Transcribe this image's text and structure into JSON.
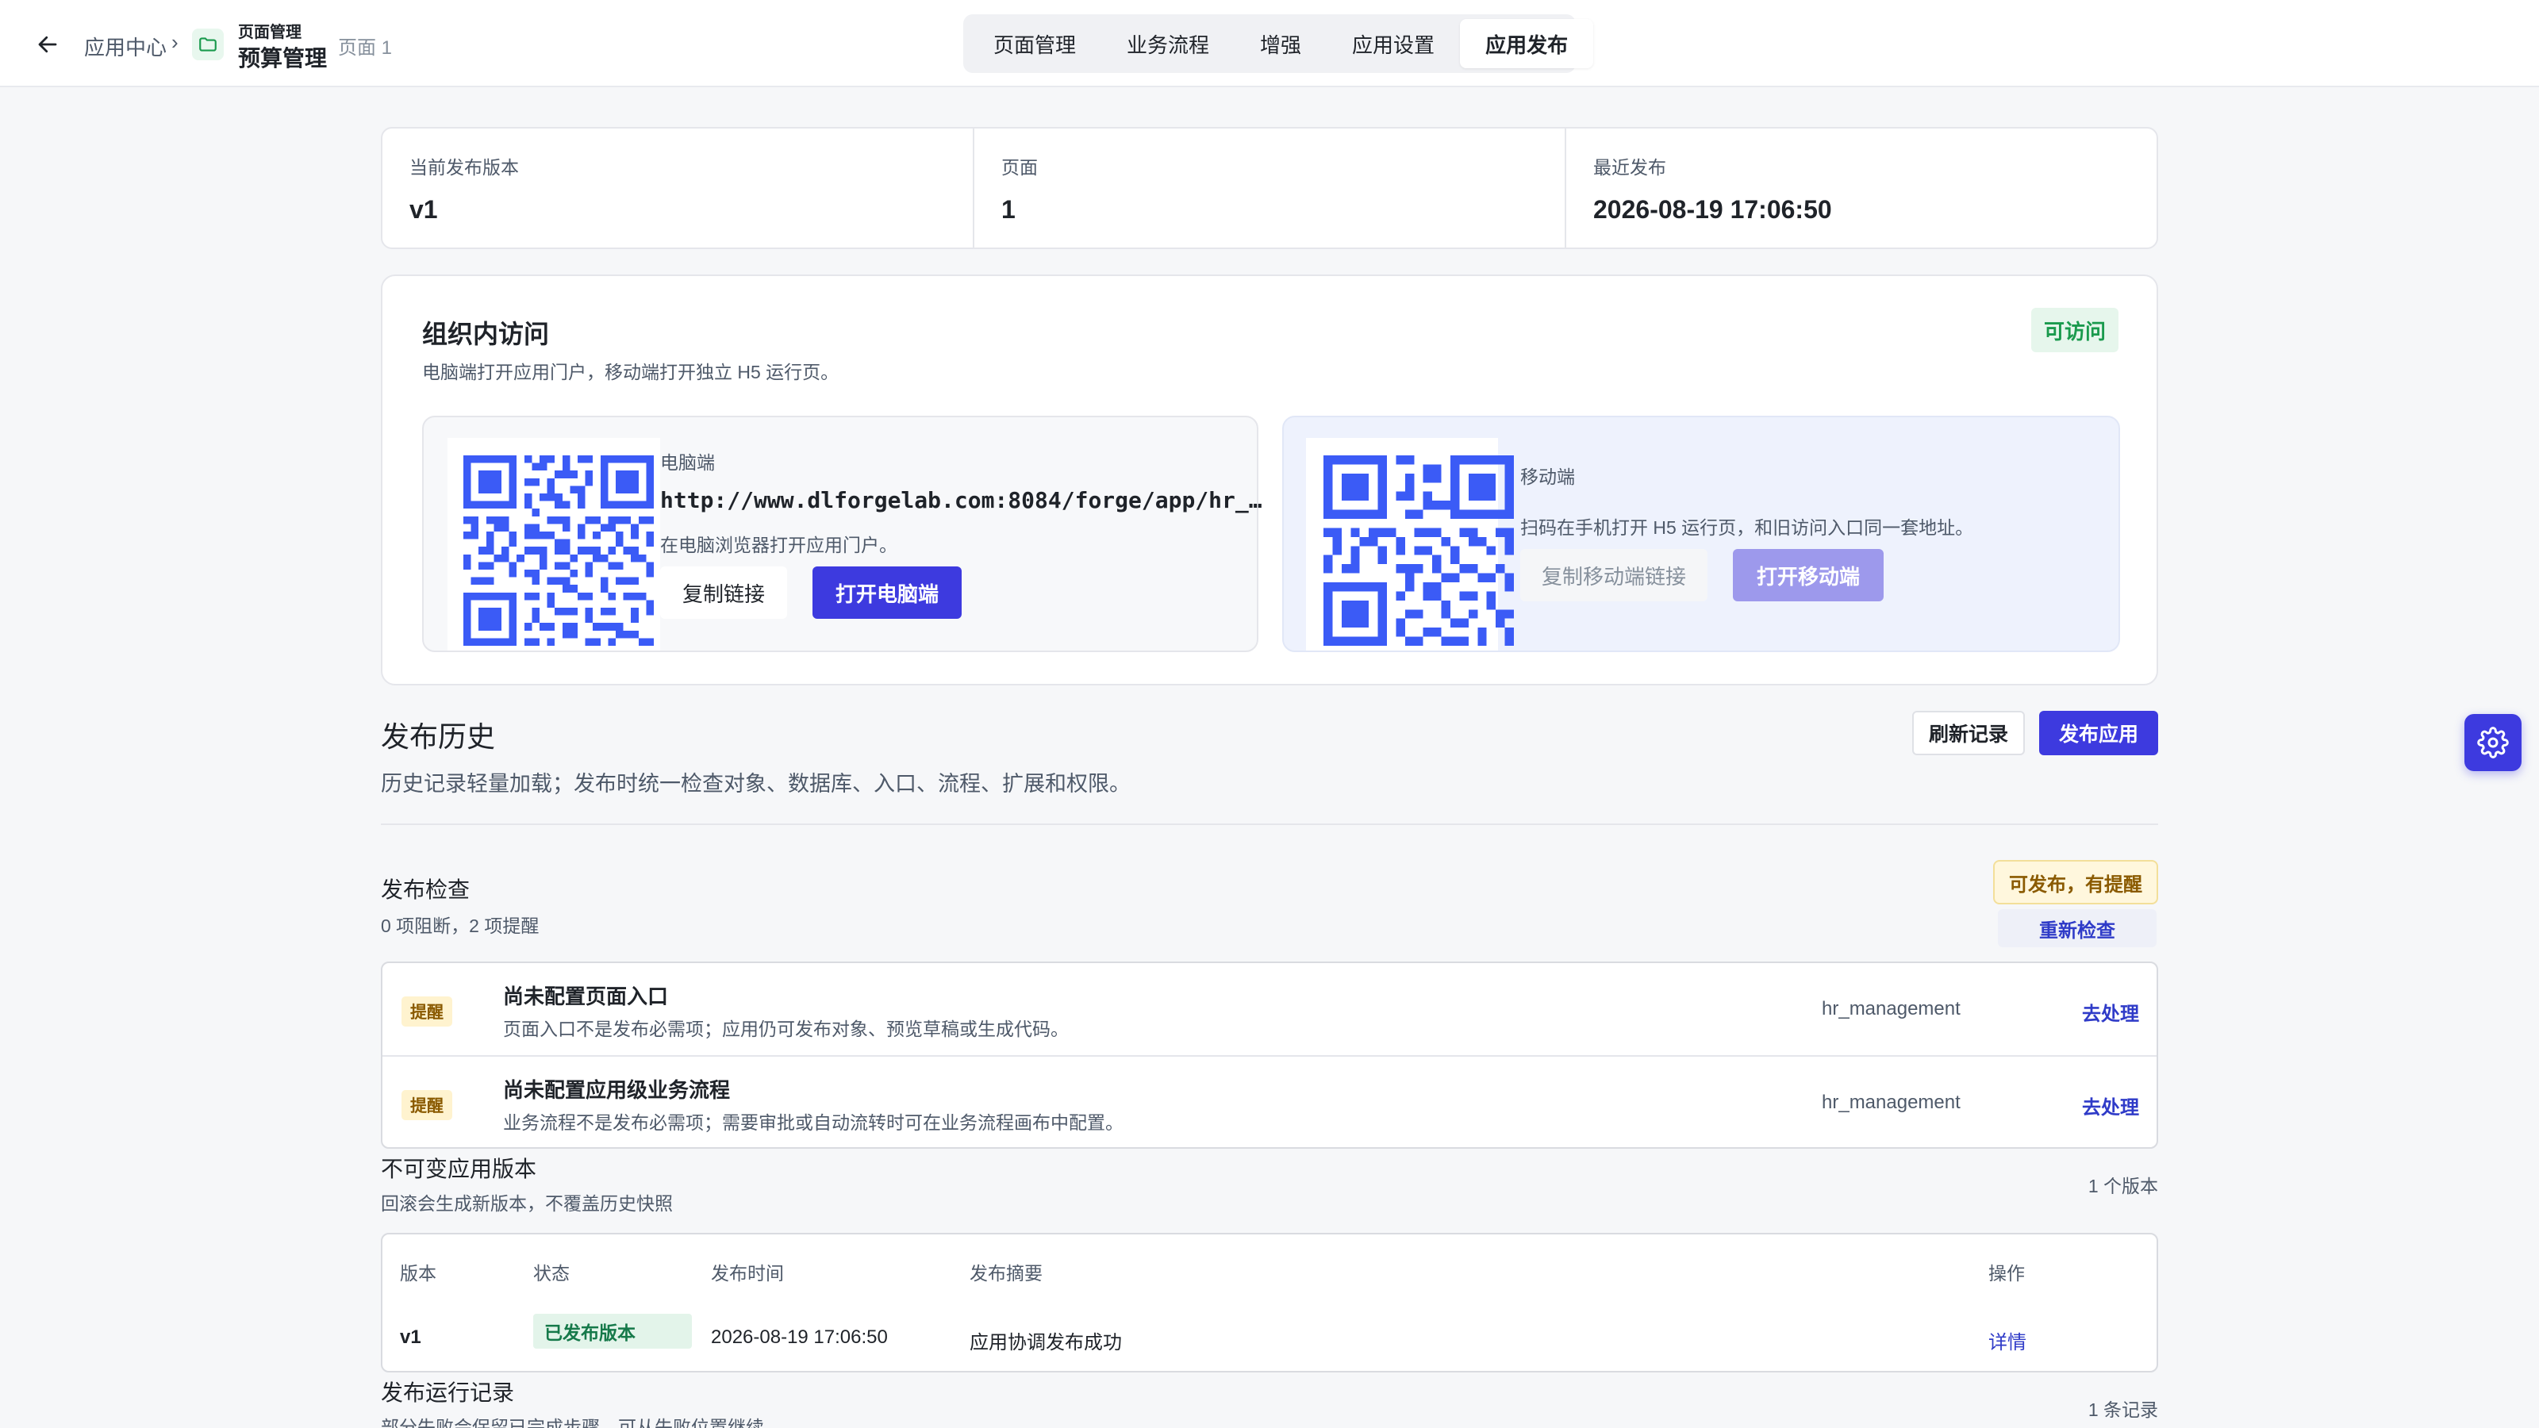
{
  "header": {
    "breadcrumb_root": "应用中心",
    "breadcrumb_sep": "›",
    "app_subtitle": "页面管理",
    "app_name": "预算管理",
    "page_label": "页面 1",
    "tabs": [
      "页面管理",
      "业务流程",
      "增强",
      "应用设置",
      "应用发布"
    ],
    "active_tab": "应用发布"
  },
  "stats": [
    {
      "label": "当前发布版本",
      "value": "v1"
    },
    {
      "label": "页面",
      "value": "1"
    },
    {
      "label": "最近发布",
      "value": "2026-08-19 17:06:50"
    }
  ],
  "access": {
    "title": "组织内访问",
    "desc": "电脑端打开应用门户，移动端打开独立 H5 运行页。",
    "badge": "可访问",
    "pc": {
      "label": "电脑端",
      "url": "http://www.dlforgelab.com:8084/forge/app/hr_…",
      "help": "在电脑浏览器打开应用门户。",
      "copy_label": "复制链接",
      "open_label": "打开电脑端"
    },
    "mobile": {
      "label": "移动端",
      "help": "扫码在手机打开 H5 运行页，和旧访问入口同一套地址。",
      "copy_label": "复制移动端链接",
      "open_label": "打开移动端"
    }
  },
  "history": {
    "title": "发布历史",
    "desc": "历史记录轻量加载；发布时统一检查对象、数据库、入口、流程、扩展和权限。",
    "refresh_label": "刷新记录",
    "publish_label": "发布应用"
  },
  "check": {
    "title": "发布检查",
    "summary": "0 项阻断，2 项提醒",
    "badge": "可发布，有提醒",
    "recheck_label": "重新检查",
    "issues": [
      {
        "tag": "提醒",
        "title": "尚未配置页面入口",
        "desc": "页面入口不是发布必需项；应用仍可发布对象、预览草稿或生成代码。",
        "target": "hr_management",
        "action": "去处理"
      },
      {
        "tag": "提醒",
        "title": "尚未配置应用级业务流程",
        "desc": "业务流程不是发布必需项；需要审批或自动流转时可在业务流程画布中配置。",
        "target": "hr_management",
        "action": "去处理"
      }
    ]
  },
  "versions": {
    "title": "不可变应用版本",
    "subtitle": "回滚会生成新版本，不覆盖历史快照",
    "count": "1 个版本",
    "columns": [
      "版本",
      "状态",
      "发布时间",
      "发布摘要",
      "操作"
    ],
    "rows": [
      {
        "version": "v1",
        "status": "已发布版本",
        "time": "2026-08-19 17:06:50",
        "summary": "应用协调发布成功",
        "action": "详情"
      }
    ]
  },
  "runs": {
    "title": "发布运行记录",
    "subtitle": "部分失败会保留已完成步骤，可从失败位置继续",
    "count": "1 条记录"
  },
  "colors": {
    "primary": "#3d3adf",
    "qr": "#3b5bf6",
    "success": "#1a9a4d",
    "warning": "#8a5a00"
  }
}
